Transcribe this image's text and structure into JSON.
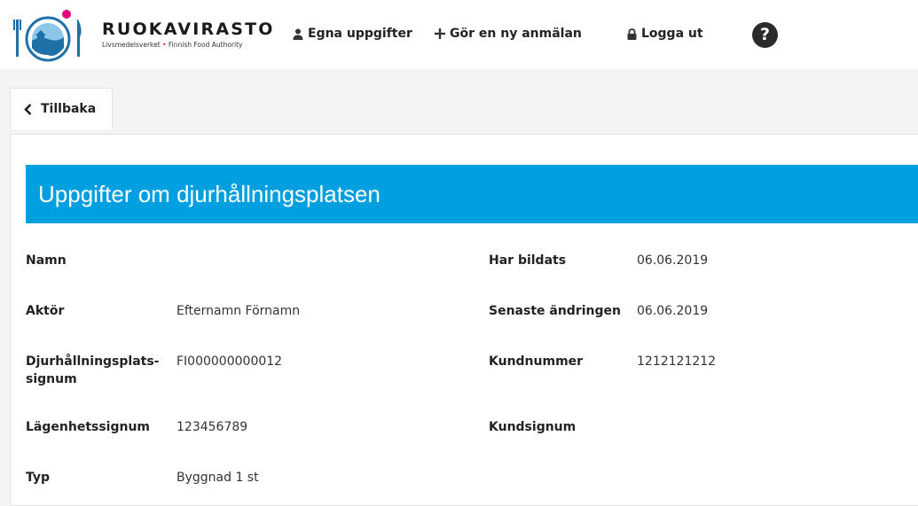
{
  "header": {
    "brand_name": "RUOKAVIRASTO",
    "brand_sub_left": "Livsmedelsverket",
    "brand_sub_dot": "•",
    "brand_sub_right": "Finnish Food Authority",
    "nav": {
      "profile_label": "Egna uppgifter",
      "new_report_label": "Gör en ny anmälan",
      "logout_label": "Logga ut",
      "help_label": "?"
    }
  },
  "back_label": "Tillbaka",
  "section_title": "Uppgifter om djurhållningsplatsen",
  "fields_left": [
    {
      "label": "Namn",
      "value": ""
    },
    {
      "label": "Aktör",
      "value": "Efternamn Förnamn"
    },
    {
      "label_line1": "Djurhållningsplats-",
      "label_line2": "signum",
      "value": "FI000000000012"
    },
    {
      "label": "Lägenhetssignum",
      "value": "123456789"
    },
    {
      "label": "Typ",
      "value": "Byggnad 1 st"
    }
  ],
  "fields_right": [
    {
      "label": "Har bildats",
      "value": "06.06.2019"
    },
    {
      "label": "Senaste ändringen",
      "value": "06.06.2019"
    },
    {
      "label": "Kundnummer",
      "value": "1212121212"
    },
    {
      "label": "Kundsignum",
      "value": ""
    }
  ],
  "colors": {
    "banner": "#009fdf",
    "logo_dot": "#e5007d",
    "logo_blue": "#1f6fa8"
  }
}
